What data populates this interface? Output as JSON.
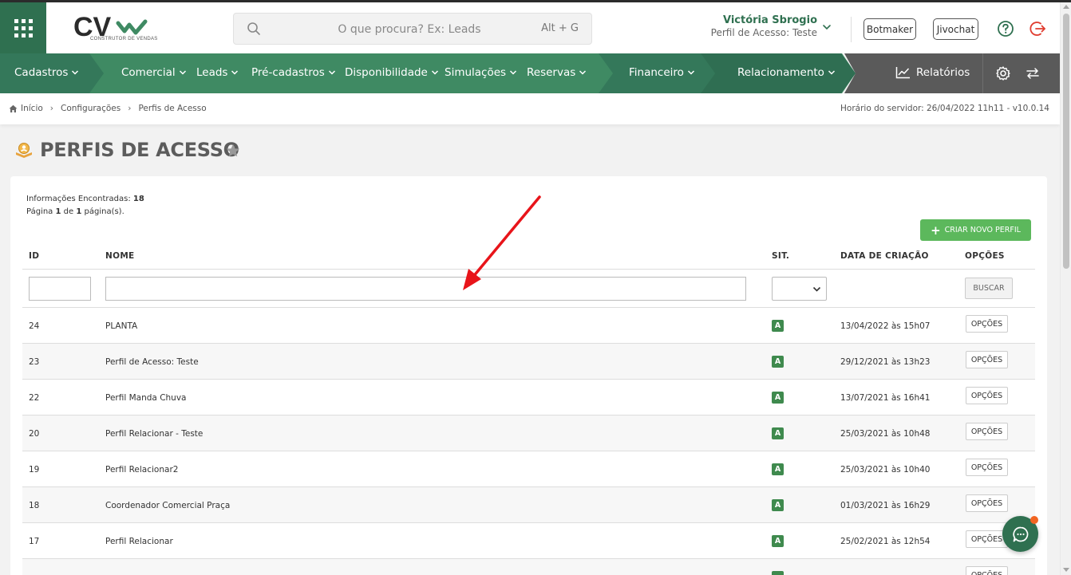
{
  "header": {
    "logo_text": "CV",
    "logo_subtitle": "CONSTRUTOR DE VENDAS",
    "search": {
      "placeholder": "O que procura? Ex: Leads",
      "shortcut": "Alt + G"
    },
    "user": {
      "name": "Victória Sbrogio",
      "profile": "Perfil de Acesso: Teste"
    },
    "buttons": {
      "botmaker": "Botmaker",
      "jivochat": "Jivochat"
    },
    "icons": [
      "apps-grid-icon",
      "search-icon",
      "chevron-down-icon",
      "help-icon",
      "exit-icon"
    ]
  },
  "nav": {
    "items": [
      "Cadastros",
      "Comercial",
      "Leads",
      "Pré-cadastros",
      "Disponibilidade",
      "Simulações",
      "Reservas",
      "Financeiro",
      "Relacionamento"
    ],
    "reports": "Relatórios",
    "colors": {
      "green": "#3f8a63",
      "dark_green": "#2f7050",
      "gray": "#5a5a5a"
    }
  },
  "breadcrumb": {
    "items": [
      "Início",
      "Configurações",
      "Perfis de Acesso"
    ],
    "server_time": "Horário do servidor: 26/04/2022 11h11 - v10.0.14"
  },
  "page": {
    "title": "PERFIS DE ACESSO",
    "info_found_label": "Informações Encontradas:",
    "info_found_count": "18",
    "page_label": "Página",
    "page_current": "1",
    "page_of": "de",
    "page_total": "1",
    "page_suffix": "página(s).",
    "create_button": "CRIAR NOVO PERFIL"
  },
  "table": {
    "columns": {
      "id": "ID",
      "name": "NOME",
      "sit": "SIT.",
      "created": "DATA DE CRIAÇÃO",
      "options": "OPÇÕES"
    },
    "search_button": "BUSCAR",
    "options_button": "OPÇÕES",
    "rows": [
      {
        "id": "24",
        "name": "PLANTA",
        "sit": "A",
        "created": "13/04/2022 às 15h07"
      },
      {
        "id": "23",
        "name": "Perfil de Acesso: Teste",
        "sit": "A",
        "created": "29/12/2021 às 13h23"
      },
      {
        "id": "22",
        "name": "Perfil Manda Chuva",
        "sit": "A",
        "created": "13/07/2021 às 16h41"
      },
      {
        "id": "20",
        "name": "Perfil Relacionar - Teste",
        "sit": "A",
        "created": "25/03/2021 às 10h48"
      },
      {
        "id": "19",
        "name": "Perfil Relacionar2",
        "sit": "A",
        "created": "25/03/2021 às 10h40"
      },
      {
        "id": "18",
        "name": "Coordenador Comercial Praça",
        "sit": "A",
        "created": "01/03/2021 às 16h29"
      },
      {
        "id": "17",
        "name": "Perfil Relacionar",
        "sit": "A",
        "created": "25/02/2021 às 12h54"
      }
    ]
  },
  "status_color": "#3f8a4e",
  "accent_button_color": "#5cb85c",
  "annotation_arrow_color": "#e8141a"
}
